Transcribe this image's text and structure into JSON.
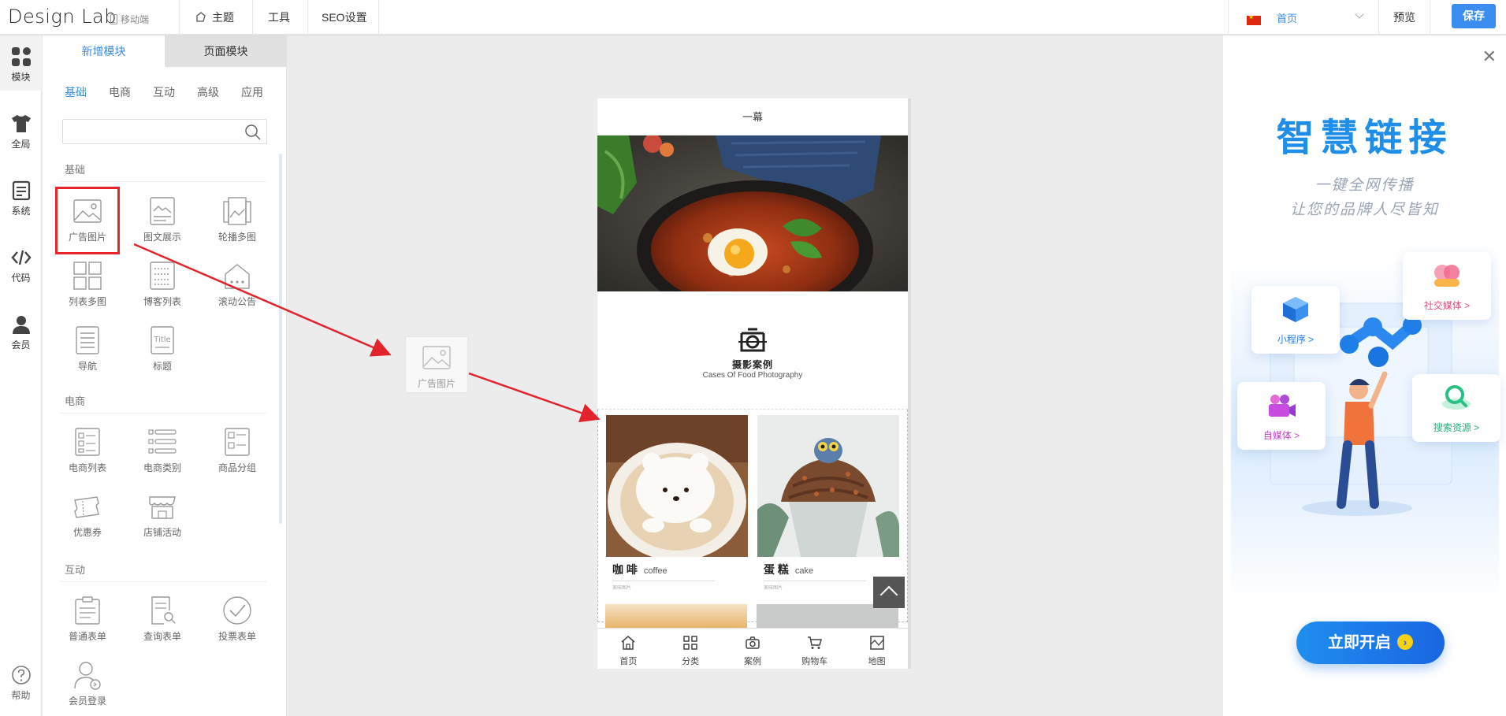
{
  "topbar": {
    "brand": "Design Lab",
    "mobile_toggle": "移动端",
    "menu": [
      "主题",
      "工具",
      "SEO设置"
    ],
    "language": "首页",
    "preview": "预览",
    "save": "保存"
  },
  "rail": {
    "items": [
      {
        "label": "模块",
        "icon": "modules-icon"
      },
      {
        "label": "全局",
        "icon": "shirt-icon"
      },
      {
        "label": "系统",
        "icon": "document-icon"
      },
      {
        "label": "代码",
        "icon": "code-icon"
      },
      {
        "label": "会员",
        "icon": "user-icon"
      }
    ],
    "help": "帮助"
  },
  "panel": {
    "tabs": [
      "新增模块",
      "页面模块"
    ],
    "categories": [
      "基础",
      "电商",
      "互动",
      "高级",
      "应用"
    ],
    "search_placeholder": "",
    "sections": {
      "basic": {
        "title": "基础",
        "items": [
          "广告图片",
          "图文展示",
          "轮播多图",
          "列表多图",
          "博客列表",
          "滚动公告",
          "导航",
          "标题"
        ]
      },
      "ecommerce": {
        "title": "电商",
        "items": [
          "电商列表",
          "电商类别",
          "商品分组",
          "优惠券",
          "店铺活动"
        ]
      },
      "interactive": {
        "title": "互动",
        "items": [
          "普通表单",
          "查询表单",
          "投票表单",
          "会员登录"
        ]
      }
    }
  },
  "ghost": {
    "label": "广告图片"
  },
  "phone": {
    "title": "一幕",
    "logo_cn": "摄影案例",
    "logo_en": "Cases Of Food Photography",
    "cards": [
      {
        "name": "咖 啡",
        "en": "coffee",
        "small": "美味图片"
      },
      {
        "name": "蛋 糕",
        "en": "cake",
        "small": "美味图片"
      }
    ],
    "tabbar": [
      "首页",
      "分类",
      "案例",
      "购物车",
      "地图"
    ]
  },
  "ad": {
    "title": "智慧链接",
    "sub1": "一键全网传播",
    "sub2": "让您的品牌人尽皆知",
    "features": [
      "小程序 >",
      "社交媒体 >",
      "自媒体 >",
      "搜索资源 >"
    ],
    "cta": "立即开启",
    "cta_arrow": "›"
  },
  "colors": {
    "accent": "#3a8be0",
    "save_button": "#3b8df0",
    "highlight": "#e8242d",
    "ad_blue": "#1f8ee8"
  }
}
